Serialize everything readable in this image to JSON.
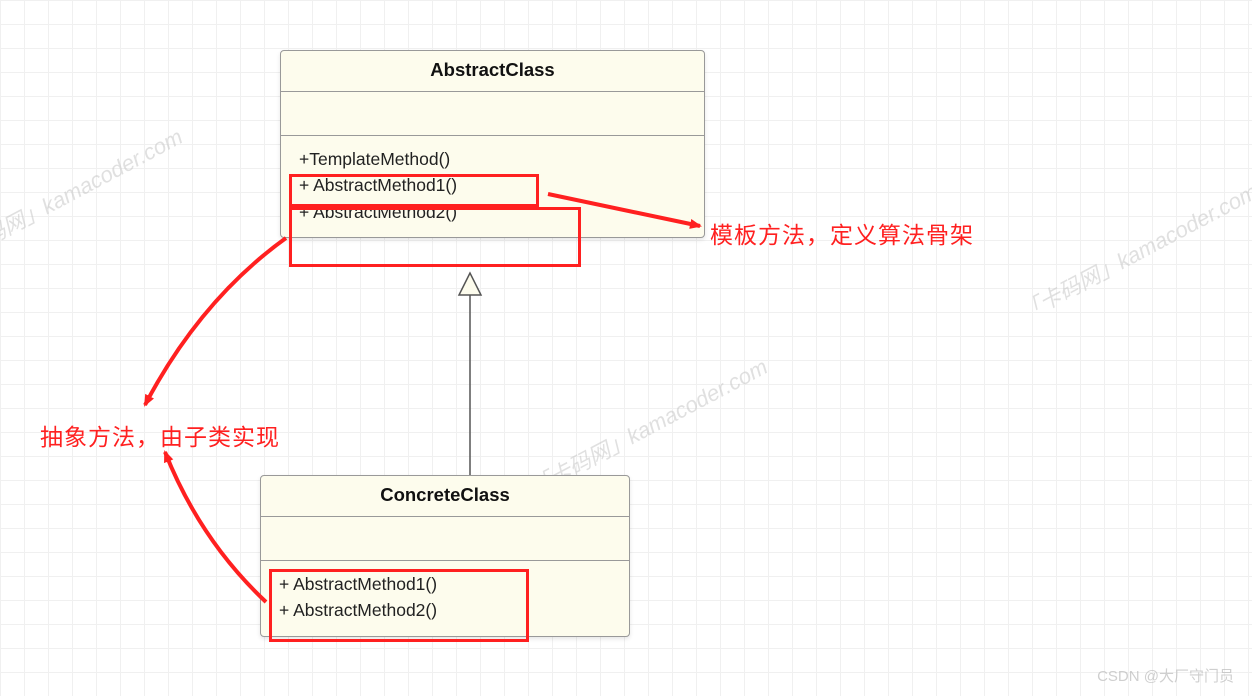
{
  "abstract_class": {
    "name": "AbstractClass",
    "methods": {
      "m1": "+TemplateMethod()",
      "m2": "+ AbstractMethod1()",
      "m3": "+ AbstractMethod2()"
    }
  },
  "concrete_class": {
    "name": "ConcreteClass",
    "methods": {
      "m1": "+ AbstractMethod1()",
      "m2": "+ AbstractMethod2()"
    }
  },
  "annotations": {
    "template_method": "模板方法，定义算法骨架",
    "abstract_method": "抽象方法，由子类实现"
  },
  "watermarks": {
    "w1": "「卡码网」kamacoder.com",
    "w2": "「卡码网」kamacoder.com",
    "w3": "「卡码网」kamacoder.com"
  },
  "footer": "CSDN @大厂守门员"
}
